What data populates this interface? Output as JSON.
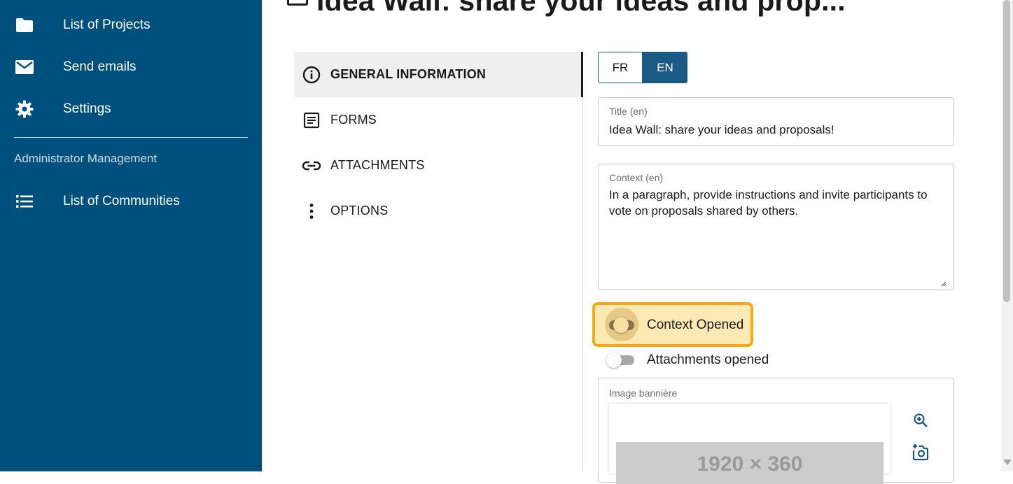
{
  "colors": {
    "sidebar_bg": "#00507d",
    "accent": "#1c5a86",
    "highlight": "#f4a915",
    "highlight_fill": "#fde9b4"
  },
  "sidebar": {
    "items": [
      {
        "label": "List of Projects",
        "icon": "folder-icon"
      },
      {
        "label": "Send emails",
        "icon": "mail-icon"
      },
      {
        "label": "Settings",
        "icon": "gear-icon"
      }
    ],
    "section_label": "Administrator Management",
    "admin_items": [
      {
        "label": "List of Communities",
        "icon": "list-icon"
      }
    ]
  },
  "header": {
    "title": "Idea Wall: share your ideas and prop..."
  },
  "tabs": [
    {
      "label": "GENERAL INFORMATION",
      "icon": "info-icon",
      "active": true
    },
    {
      "label": "FORMS",
      "icon": "form-icon",
      "active": false
    },
    {
      "label": "ATTACHMENTS",
      "icon": "link-icon",
      "active": false
    },
    {
      "label": "OPTIONS",
      "icon": "more-vert-icon",
      "active": false
    }
  ],
  "language": {
    "options": [
      "FR",
      "EN"
    ],
    "selected": "EN"
  },
  "form": {
    "title_label": "Title (en)",
    "title_value": "Idea Wall: share your ideas and proposals!",
    "context_label": "Context (en)",
    "context_value": "In a paragraph, provide instructions and invite participants to vote on proposals shared by others.",
    "context_opened_label": "Context Opened",
    "context_opened_on": true,
    "attachments_opened_label": "Attachments opened",
    "attachments_opened_on": false,
    "banner_label": "Image bannière",
    "banner_placeholder": "1920 × 360",
    "banner_actions": [
      "zoom-in-icon",
      "add-photo-icon"
    ]
  }
}
